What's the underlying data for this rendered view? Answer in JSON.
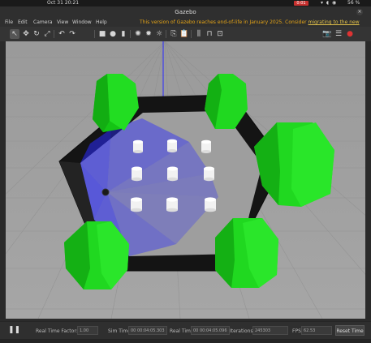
{
  "system": {
    "date": "Oct 31  20:21",
    "rec": "0:01",
    "battery": "56 %"
  },
  "window": {
    "title": "Gazebo",
    "close": "×"
  },
  "menu": {
    "file": "File",
    "edit": "Edit",
    "camera": "Camera",
    "view": "View",
    "window": "Window",
    "help": "Help",
    "notice_text": "This version of Gazebo reaches end-of-life in January 2025. Consider ",
    "notice_link": "migrating to the new Gazebo"
  },
  "toolbar": {
    "select": "↖",
    "translate": "✥",
    "rotate": "↻",
    "scale": "⤢",
    "undo": "↶",
    "redo": "↷",
    "box": "■",
    "sphere": "●",
    "cylinder": "▮",
    "point_light": "✺",
    "spot_light": "✹",
    "dir_light": "☼",
    "copy": "⎘",
    "paste": "📋",
    "align": "⫼",
    "snap": "⊓",
    "change_view": "⊡",
    "screenshot": "📷",
    "log": "☰",
    "record": "●"
  },
  "status": {
    "pause": "❚❚",
    "real_time_factor_label": "Real Time Factor:",
    "real_time_factor_value": "1.00",
    "sim_time_label": "Sim Time",
    "sim_time_value": "00 00:04:05.303",
    "real_time_label": "Real Time",
    "real_time_value": "00 00:04:05.096",
    "iterations_label": "Iterations",
    "iterations_value": "245303",
    "fps_label": "FPS",
    "fps_value": "62.53",
    "reset_label": "Reset Time"
  },
  "colors": {
    "ground": "#9f9f9f",
    "wall": "#131313",
    "obstacle": "#ffffff",
    "tree": "#1fd61f",
    "laser": "#2020ff",
    "notice": "#e3a317"
  }
}
